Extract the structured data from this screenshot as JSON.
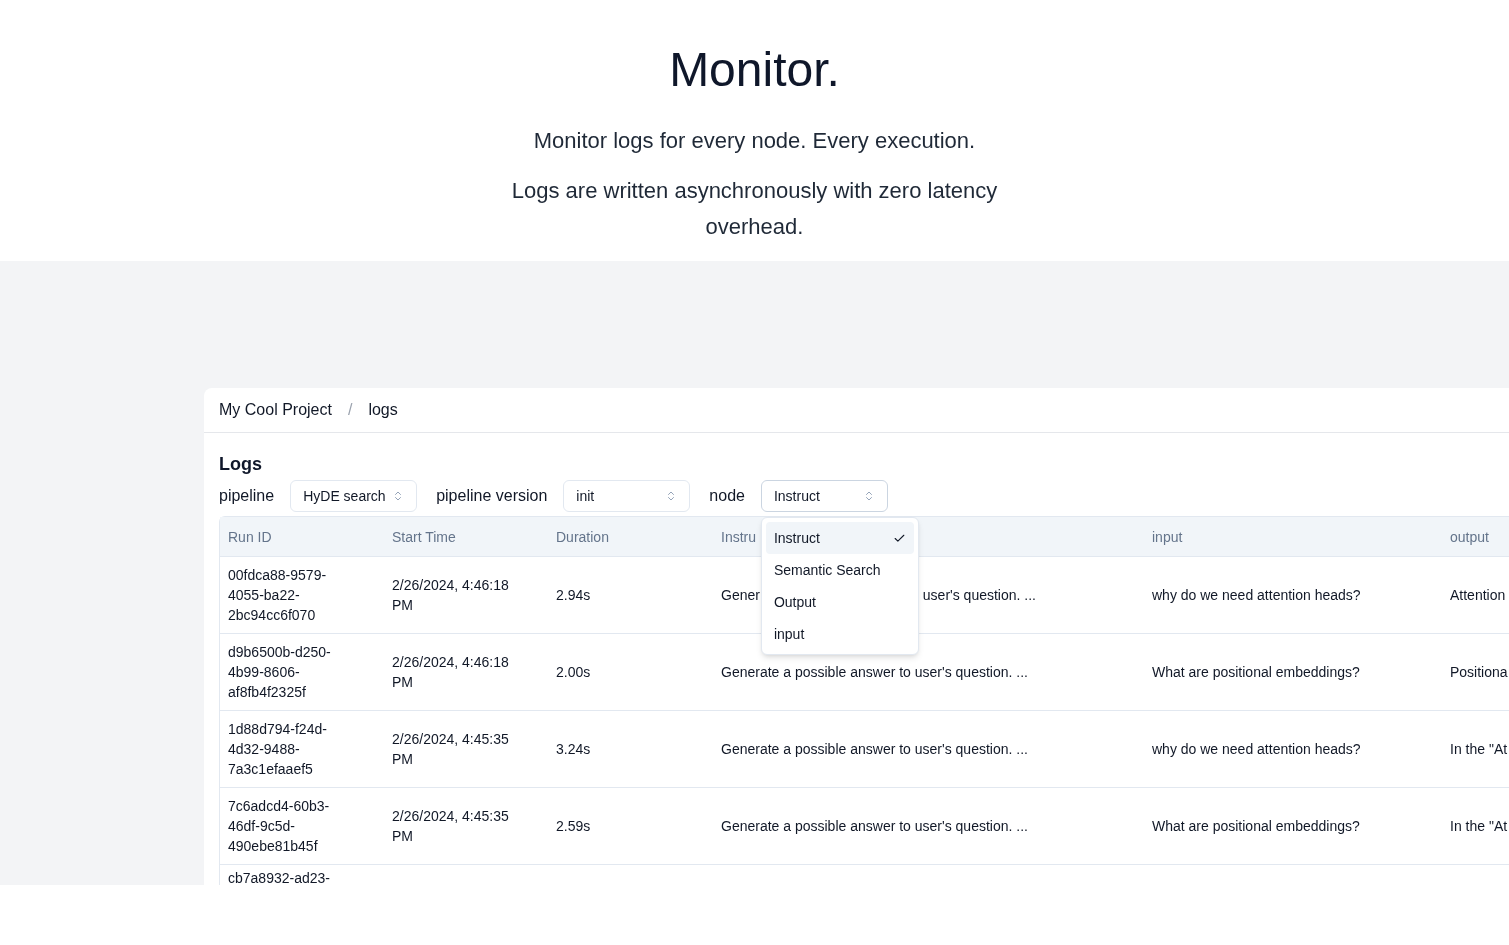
{
  "hero": {
    "title": "Monitor.",
    "subtitle": "Monitor logs for every node. Every execution.",
    "description": "Logs are written asynchronously with zero latency overhead."
  },
  "breadcrumb": {
    "items": [
      "My Cool Project",
      "logs"
    ],
    "separator": "/"
  },
  "logs": {
    "title": "Logs",
    "filters": [
      {
        "label": "pipeline",
        "value": "HyDE search",
        "expanded": false
      },
      {
        "label": "pipeline version",
        "value": "init",
        "expanded": false
      },
      {
        "label": "node",
        "value": "Instruct",
        "expanded": true,
        "options": [
          {
            "label": "Instruct",
            "selected": true
          },
          {
            "label": "Semantic Search",
            "selected": false
          },
          {
            "label": "Output",
            "selected": false
          },
          {
            "label": "input",
            "selected": false
          }
        ]
      }
    ],
    "table": {
      "columns": [
        "Run ID",
        "Start Time",
        "Duration",
        "Instru",
        "input",
        "output"
      ],
      "rows": [
        {
          "run_id": "00fdca88-9579-4055-ba22-2bc94cc6f070",
          "start_time": "2/26/2024, 4:46:18 PM",
          "duration": "2.94s",
          "instruct": [
            "Gener",
            "user's question. ..."
          ],
          "input": "why do we need attention heads?",
          "output": "Attention"
        },
        {
          "run_id": "d9b6500b-d250-4b99-8606-af8fb4f2325f",
          "start_time": "2/26/2024, 4:46:18 PM",
          "duration": "2.00s",
          "instruct": [
            "Generate a possible answer to user's question. ..."
          ],
          "input": "What are positional embeddings?",
          "output": "Positiona"
        },
        {
          "run_id": "1d88d794-f24d-4d32-9488-7a3c1efaaef5",
          "start_time": "2/26/2024, 4:45:35 PM",
          "duration": "3.24s",
          "instruct": [
            "Generate a possible answer to user's question. ..."
          ],
          "input": "why do we need attention heads?",
          "output": "In the \"At"
        },
        {
          "run_id": "7c6adcd4-60b3-46df-9c5d-490ebe81b45f",
          "start_time": "2/26/2024, 4:45:35 PM",
          "duration": "2.59s",
          "instruct": [
            "Generate a possible answer to user's question. ..."
          ],
          "input": "What are positional embeddings?",
          "output": "In the \"At"
        },
        {
          "run_id": "cb7a8932-ad23-"
        }
      ]
    }
  }
}
